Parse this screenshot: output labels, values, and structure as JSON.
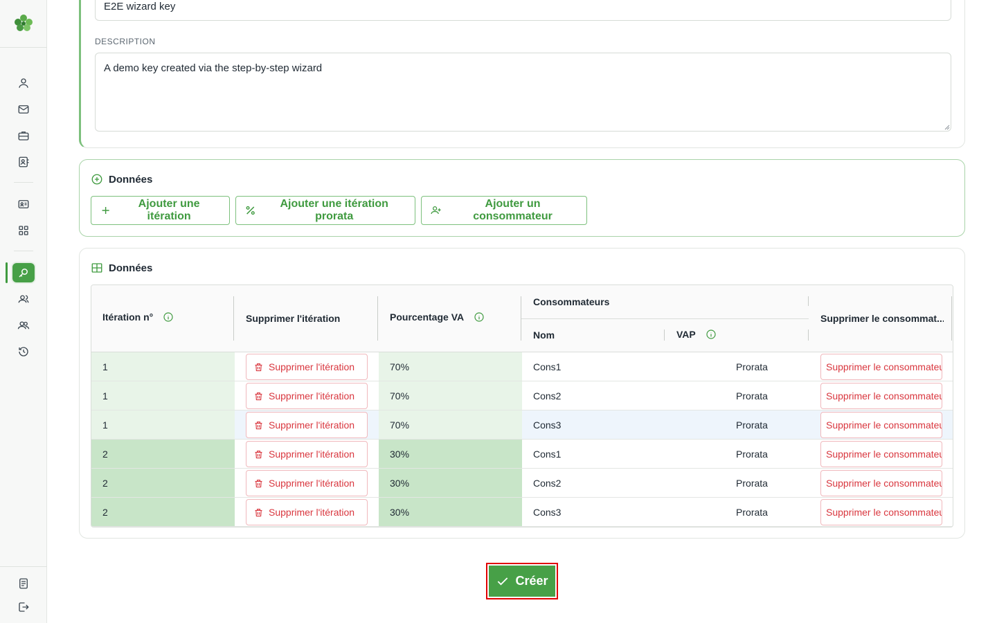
{
  "form": {
    "name_value": "E2E wizard key",
    "description_label": "DESCRIPTION",
    "description_value": "A demo key created via the step-by-step wizard"
  },
  "data_actions": {
    "title": "Données",
    "add_iteration": "Ajouter une itération",
    "add_prorata_iteration": "Ajouter une itération prorata",
    "add_consumer": "Ajouter un consommateur"
  },
  "data_table": {
    "title": "Données",
    "headers": {
      "iteration": "Itération n°",
      "delete_iteration": "Supprimer l'itération",
      "percentage": "Pourcentage VA",
      "consumers": "Consommateurs",
      "name": "Nom",
      "vap": "VAP",
      "delete_consumer": "Supprimer le consommat..."
    },
    "delete_iteration_label": "Supprimer l'itération",
    "delete_consumer_label": "Supprimer le consommateur",
    "rows": [
      {
        "iteration": "1",
        "percentage": "70%",
        "name": "Cons1",
        "vap": "Prorata"
      },
      {
        "iteration": "1",
        "percentage": "70%",
        "name": "Cons2",
        "vap": "Prorata"
      },
      {
        "iteration": "1",
        "percentage": "70%",
        "name": "Cons3",
        "vap": "Prorata"
      },
      {
        "iteration": "2",
        "percentage": "30%",
        "name": "Cons1",
        "vap": "Prorata"
      },
      {
        "iteration": "2",
        "percentage": "30%",
        "name": "Cons2",
        "vap": "Prorata"
      },
      {
        "iteration": "2",
        "percentage": "30%",
        "name": "Cons3",
        "vap": "Prorata"
      }
    ]
  },
  "submit": {
    "label": "Créer"
  },
  "sidebar": {
    "items": [
      "user-icon",
      "mail-icon",
      "briefcase-icon",
      "contact-book-icon",
      "id-card-icon",
      "grid-icon",
      "key-search-icon",
      "users-icon",
      "users-alt-icon",
      "history-icon",
      "document-icon",
      "logout-icon"
    ]
  },
  "colors": {
    "accent": "#47a047",
    "danger": "#d9363e",
    "iteration1_bg": "#e8f4e8",
    "iteration2_bg": "#c8e5c8",
    "highlight_row": "#eef5fc"
  }
}
